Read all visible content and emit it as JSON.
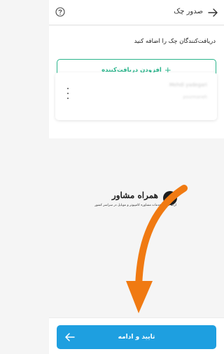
{
  "header": {
    "title": "صدور چک",
    "back_icon": "arrow-right-icon",
    "help_icon": "question-circle-icon"
  },
  "main": {
    "instruction": "دریافت‌کنندگان چک را اضافه کنید",
    "add_button": {
      "label": "افزودن دریافت‌کننده",
      "icon": "plus-icon"
    }
  },
  "recipient_card": {
    "name": "Mehdi yadegari",
    "subtitle": "pourmaneh",
    "menu_icon": "more-vertical-icon"
  },
  "watermark": {
    "title": "همراه مشاور",
    "subtitle": "ارائه دهنده خدمات مشاوره کامپیوتر و موبایل در سراسر کشور",
    "logo_icon": "hamrah-moshaver-logo"
  },
  "footer": {
    "confirm_button": {
      "label": "تایید و ادامه",
      "icon": "arrow-left-icon"
    }
  },
  "colors": {
    "accent_green": "#2bb58c",
    "primary_blue": "#1e9fe0",
    "annotation_orange": "#f07a12"
  }
}
